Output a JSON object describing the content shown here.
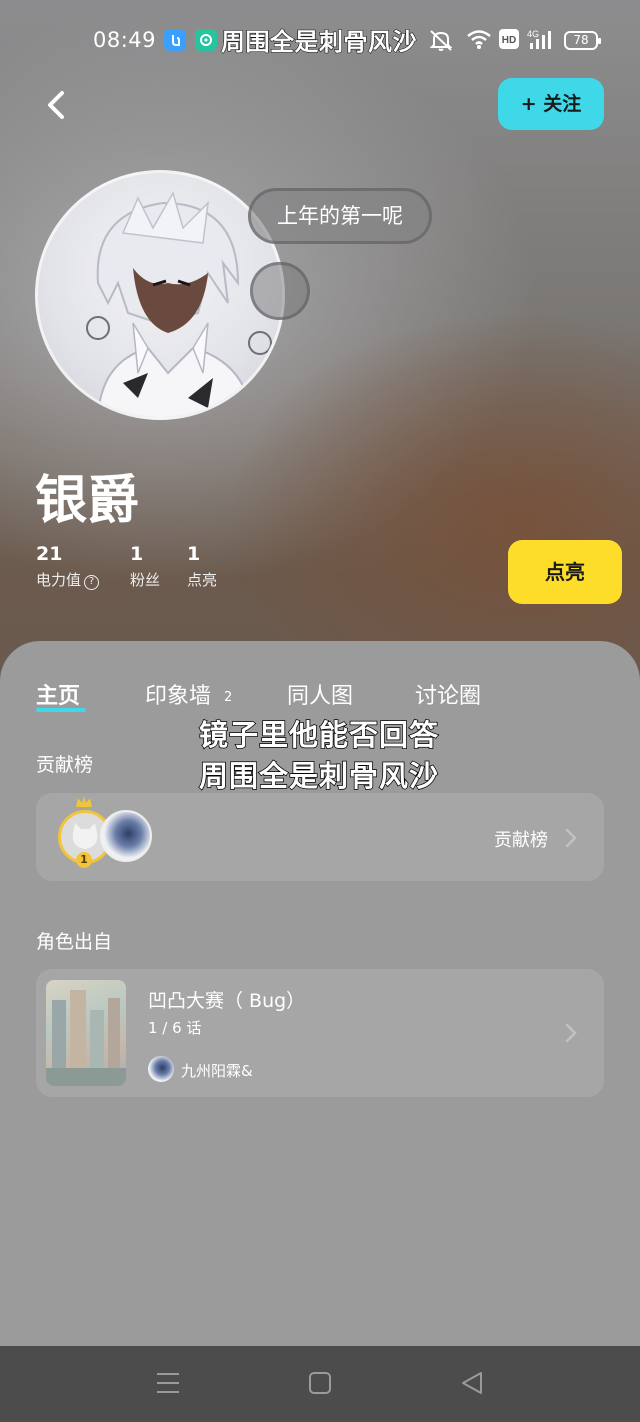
{
  "status_bar": {
    "time": "08:49",
    "lyric": "周围全是刺骨风沙",
    "hd_label": "HD",
    "net_label": "4G",
    "battery": "78",
    "icons": [
      "app-blue-icon",
      "app-green-icon",
      "bell-off-icon",
      "wifi-icon",
      "hd-icon",
      "signal-4g-icon",
      "battery-icon"
    ]
  },
  "header": {
    "back_icon": "back-arrow-icon",
    "follow_label": "+ 关注"
  },
  "profile": {
    "bubble_text": "上年的第一呢",
    "name": "银爵",
    "stats": [
      {
        "value": "21",
        "label": "电力值"
      },
      {
        "value": "1",
        "label": "粉丝"
      },
      {
        "value": "1",
        "label": "点亮"
      }
    ],
    "help_glyph": "?",
    "light_button": "点亮"
  },
  "tabs": {
    "items": [
      "主页",
      "印象墙",
      "同人图",
      "讨论圈"
    ],
    "wall_count": "2",
    "active": "主页"
  },
  "lyrics_overlay": {
    "line1": "镜子里他能否回答",
    "line2": "周围全是刺骨风沙"
  },
  "contribution": {
    "section_title": "贡献榜",
    "rank_number": "1",
    "link_label": "贡献榜"
  },
  "source": {
    "section_title": "角色出自",
    "work_title": "凹凸大赛（ Bug）",
    "episodes": "1 / 6 话",
    "author": "九州阳霖&"
  },
  "nav": {
    "icons": [
      "menu-icon",
      "home-square-icon",
      "back-triangle-icon"
    ]
  },
  "colors": {
    "accent_cyan": "#3fd8e8",
    "accent_yellow": "#fddc2a",
    "panel_gray": "#9b9b9b",
    "navbar": "#4c4c4c"
  }
}
